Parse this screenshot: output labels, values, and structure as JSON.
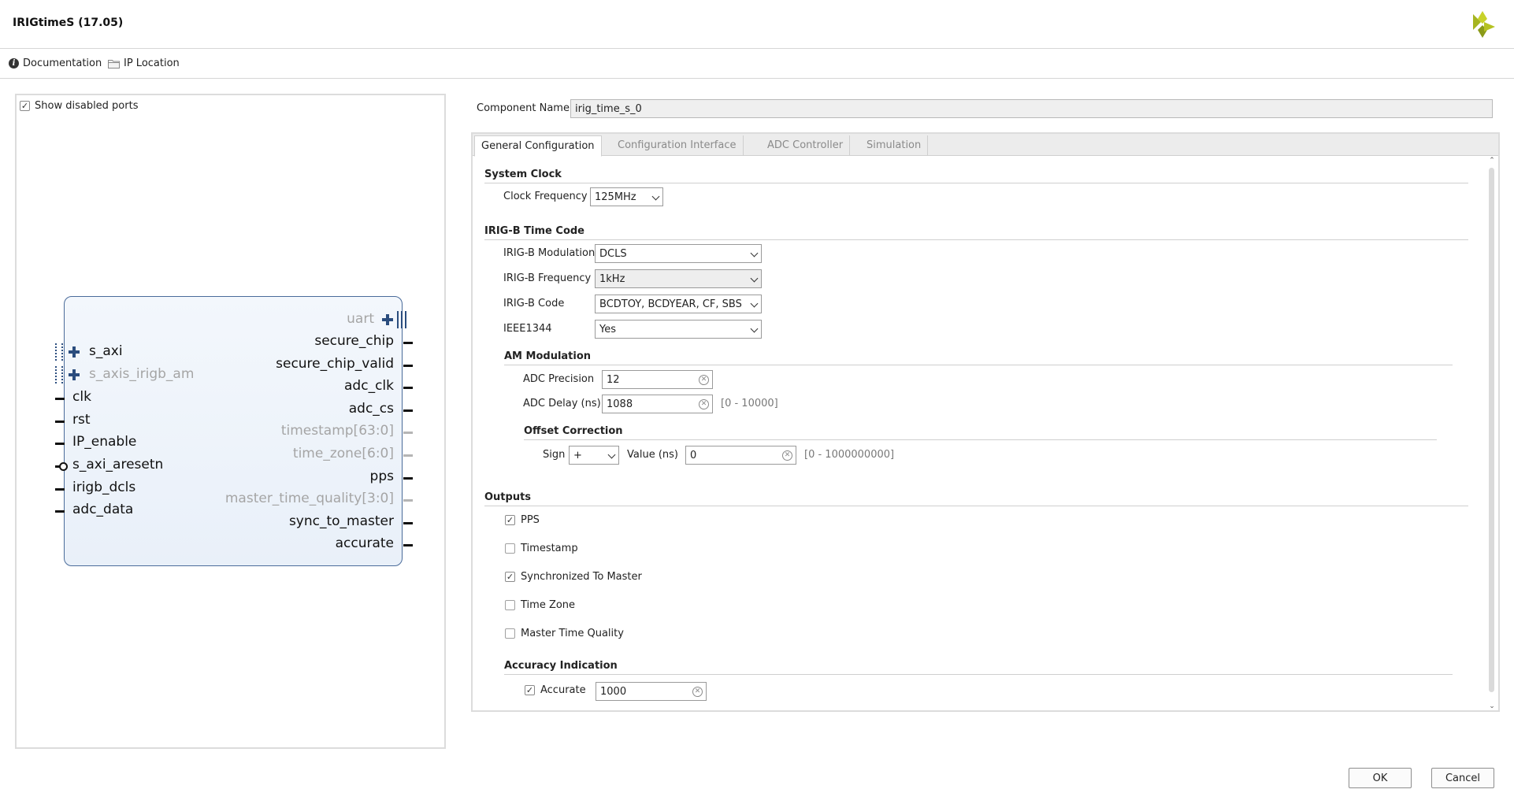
{
  "window": {
    "title": "IRIGtimeS (17.05)",
    "logo_icon": "xilinx-logo-icon"
  },
  "toolbar": {
    "documentation": "Documentation",
    "ip_location": "IP Location"
  },
  "left_panel": {
    "show_disabled_ports": {
      "label": "Show disabled ports",
      "checked": true
    },
    "block": {
      "left_ports": [
        {
          "name": "s_axi",
          "bus": true,
          "enabled": true
        },
        {
          "name": "s_axis_irigb_am",
          "bus": true,
          "enabled": false
        },
        {
          "name": "clk",
          "enabled": true
        },
        {
          "name": "rst",
          "enabled": true
        },
        {
          "name": "IP_enable",
          "enabled": true
        },
        {
          "name": "s_axi_aresetn",
          "enabled": true,
          "active_low": true
        },
        {
          "name": "irigb_dcls",
          "enabled": true
        },
        {
          "name": "adc_data",
          "enabled": true
        }
      ],
      "right_ports": [
        {
          "name": "uart",
          "bus": true,
          "enabled": false
        },
        {
          "name": "secure_chip",
          "enabled": true
        },
        {
          "name": "secure_chip_valid",
          "enabled": true
        },
        {
          "name": "adc_clk",
          "enabled": true
        },
        {
          "name": "adc_cs",
          "enabled": true
        },
        {
          "name": "timestamp[63:0]",
          "enabled": false
        },
        {
          "name": "time_zone[6:0]",
          "enabled": false
        },
        {
          "name": "pps",
          "enabled": true
        },
        {
          "name": "master_time_quality[3:0]",
          "enabled": false
        },
        {
          "name": "sync_to_master",
          "enabled": true
        },
        {
          "name": "accurate",
          "enabled": true
        }
      ]
    }
  },
  "component": {
    "label": "Component Name",
    "value": "irig_time_s_0"
  },
  "tabs": [
    {
      "label": "General Configuration",
      "active": true
    },
    {
      "label": "Configuration Interface",
      "active": false
    },
    {
      "label": "ADC Controller",
      "active": false
    },
    {
      "label": "Simulation",
      "active": false
    }
  ],
  "general": {
    "system_clock": {
      "title": "System Clock",
      "clock_frequency": {
        "label": "Clock Frequency",
        "value": "125MHz"
      }
    },
    "irigb": {
      "title": "IRIG-B Time Code",
      "modulation": {
        "label": "IRIG-B Modulation",
        "value": "DCLS"
      },
      "frequency": {
        "label": "IRIG-B Frequency",
        "value": "1kHz"
      },
      "code": {
        "label": "IRIG-B Code",
        "value": "BCDTOY, BCDYEAR, CF, SBS"
      },
      "ieee1344": {
        "label": "IEEE1344",
        "value": "Yes"
      }
    },
    "am_modulation": {
      "title": "AM Modulation",
      "adc_precision": {
        "label": "ADC Precision",
        "value": "12"
      },
      "adc_delay": {
        "label": "ADC Delay (ns)",
        "value": "1088",
        "range": "[0 - 10000]"
      },
      "offset": {
        "title": "Offset Correction",
        "sign": {
          "label": "Sign",
          "value": "+"
        },
        "value": {
          "label": "Value (ns)",
          "value": "0",
          "range": "[0 - 1000000000]"
        }
      }
    },
    "outputs": {
      "title": "Outputs",
      "items": [
        {
          "label": "PPS",
          "checked": true
        },
        {
          "label": "Timestamp",
          "checked": false
        },
        {
          "label": "Synchronized To Master",
          "checked": true
        },
        {
          "label": "Time Zone",
          "checked": false
        },
        {
          "label": "Master Time Quality",
          "checked": false
        }
      ]
    },
    "accuracy": {
      "title": "Accuracy Indication",
      "accurate": {
        "label": "Accurate",
        "checked": true,
        "value": "1000"
      }
    }
  },
  "buttons": {
    "ok": "OK",
    "cancel": "Cancel"
  }
}
